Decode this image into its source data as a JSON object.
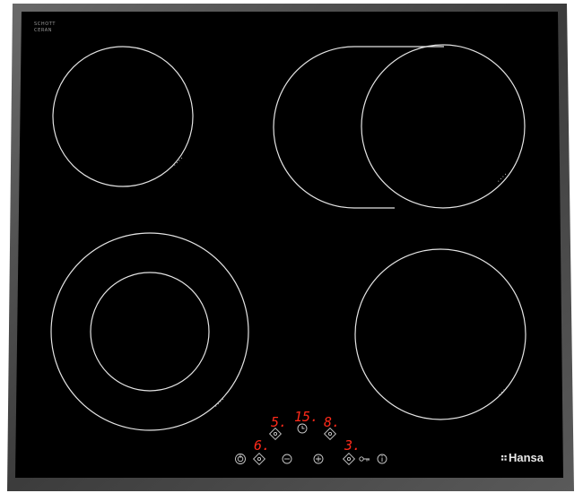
{
  "brand": {
    "name": "Hansa"
  },
  "glass_logo": {
    "line1": "SCHOTT",
    "line2": "CERAN"
  },
  "zone_marker": "• • • •",
  "displays": {
    "zone_top_left": "5.",
    "timer": "15.",
    "zone_top_right": "8.",
    "zone_bottom_left": "6.",
    "zone_bottom_right": "3."
  },
  "icons": {
    "power": "power-icon",
    "minus": "minus-icon",
    "plus": "plus-icon",
    "lock": "key-lock-icon",
    "info": "info-icon",
    "clock": "clock-icon",
    "zone_select": "zone-select-icon"
  },
  "colors": {
    "glass": "#000000",
    "frame": "#4a4a4a",
    "display": "#ff2a1a",
    "rings": "#e4e4e4"
  }
}
